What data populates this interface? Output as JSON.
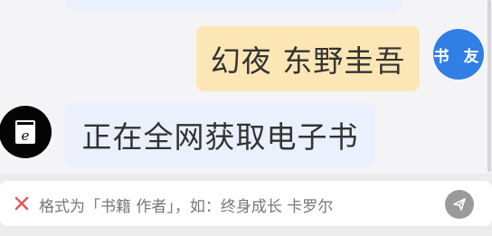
{
  "chat": {
    "messages": [
      {
        "role": "user",
        "avatar_label": "书 友",
        "text": "幻夜 东野圭吾"
      },
      {
        "role": "bot",
        "text": "正在全网获取电子书"
      }
    ]
  },
  "input": {
    "placeholder": "格式为「书籍 作者」，如：终身成长 卡罗尔",
    "clear_icon": "close-icon",
    "send_icon": "send-icon"
  },
  "colors": {
    "user_bubble": "#fde6b5",
    "bot_bubble": "#ebf0fd",
    "user_avatar": "#2f7fe4",
    "bot_avatar": "#050505",
    "clear_icon": "#e05a5a",
    "send_button": "#9a9a9a"
  }
}
